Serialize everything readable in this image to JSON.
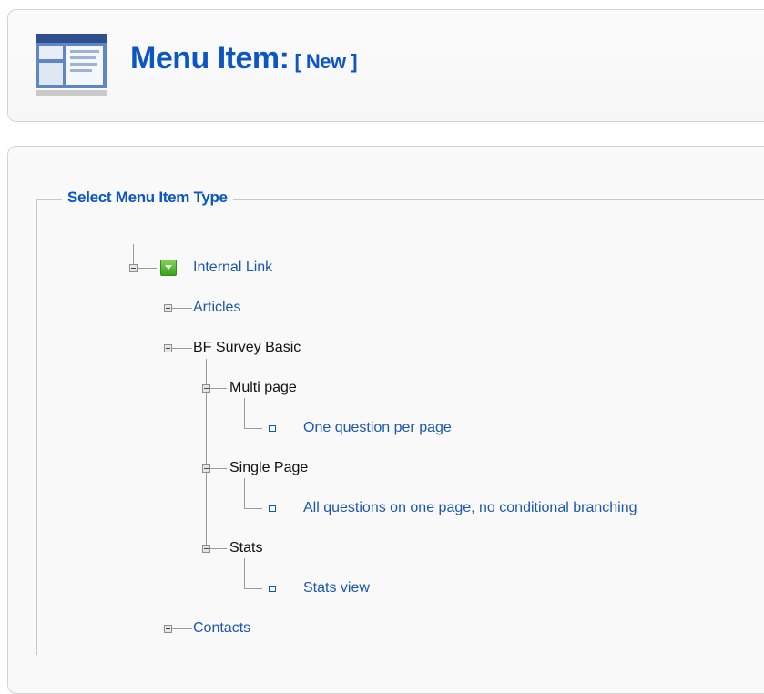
{
  "header": {
    "title": "Menu Item:",
    "subtitle": "[ New ]",
    "icon": "menu-item-icon"
  },
  "fieldset": {
    "legend": "Select Menu Item Type"
  },
  "tree": {
    "root": {
      "label": "Internal Link",
      "icon": "green-dropdown-icon",
      "expanded": true
    },
    "articles": {
      "label": "Articles",
      "expanded": false
    },
    "bf_survey": {
      "label": "BF Survey Basic",
      "expanded": true
    },
    "multi_page": {
      "label": "Multi page",
      "expanded": true
    },
    "multi_page_leaf": {
      "label": "One question per page"
    },
    "single_page": {
      "label": "Single Page",
      "expanded": true
    },
    "single_page_leaf": {
      "label": "All questions on one page, no conditional branching"
    },
    "stats": {
      "label": "Stats",
      "expanded": true
    },
    "stats_leaf": {
      "label": "Stats view"
    },
    "contacts": {
      "label": "Contacts",
      "expanded": false
    }
  },
  "colors": {
    "accent": "#0b55c4",
    "link": "#1b57b1",
    "tree_line": "#9a9a9a",
    "border": "#d4d4d4"
  }
}
